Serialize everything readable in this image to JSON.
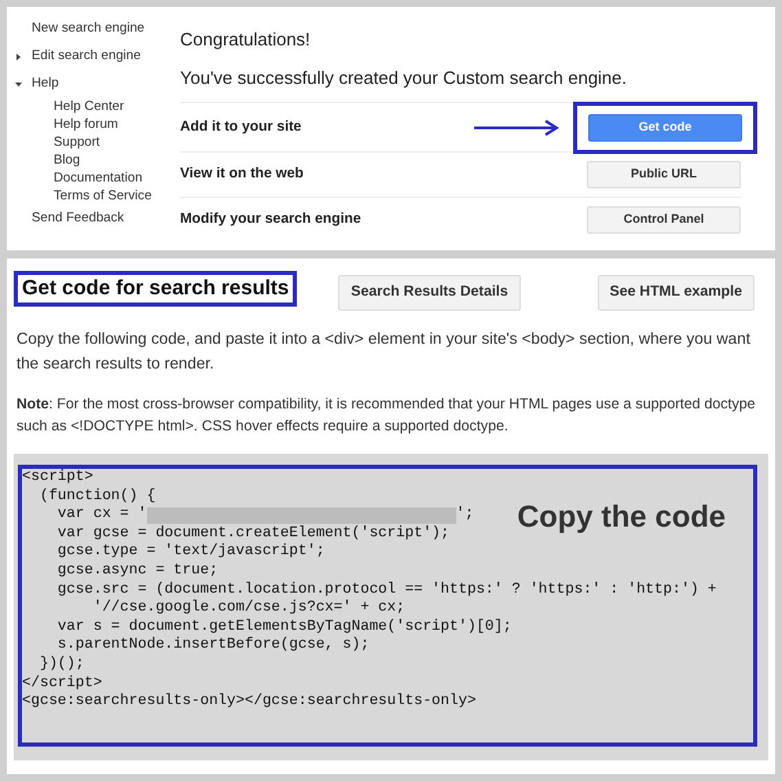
{
  "sidebar": {
    "items": [
      {
        "kind": "link",
        "label": "New search engine"
      },
      {
        "kind": "expandable",
        "label": "Edit search engine",
        "expanded": false
      },
      {
        "kind": "expandable",
        "label": "Help",
        "expanded": true,
        "children": [
          "Help Center",
          "Help forum",
          "Support",
          "Blog",
          "Documentation",
          "Terms of Service"
        ]
      },
      {
        "kind": "link",
        "label": "Send Feedback"
      }
    ]
  },
  "top": {
    "heading": "Congratulations!",
    "subheading": "You've successfully created your Custom search engine.",
    "rows": [
      {
        "label": "Add it to your site",
        "button": "Get code",
        "primary": true,
        "highlighted": true
      },
      {
        "label": "View it on the web",
        "button": "Public URL",
        "primary": false,
        "highlighted": false
      },
      {
        "label": "Modify your search engine",
        "button": "Control Panel",
        "primary": false,
        "highlighted": false
      }
    ]
  },
  "bottom": {
    "title": "Get code for search results",
    "title_highlighted": true,
    "buttons": [
      "Search Results Details",
      "See HTML example"
    ],
    "intro": "Copy the following code, and paste it into a <div> element in your site's <body> section, where you want the search results to render.",
    "note": "**Note**: For the most cross-browser compatibility, it is recommended that your HTML pages use a supported doctype such as <!DOCTYPE html>. CSS hover effects require a supported doctype.",
    "code_callout": "Copy the code",
    "code_lines": [
      {
        "kind": "text",
        "text": "<script>"
      },
      {
        "kind": "text",
        "text": "  (function() {"
      },
      {
        "kind": "redacted",
        "before": "    var cx = '",
        "after": "';"
      },
      {
        "kind": "text",
        "text": "    var gcse = document.createElement('script');"
      },
      {
        "kind": "text",
        "text": "    gcse.type = 'text/javascript';"
      },
      {
        "kind": "text",
        "text": "    gcse.async = true;"
      },
      {
        "kind": "text",
        "text": "    gcse.src = (document.location.protocol == 'https:' ? 'https:' : 'http:') +"
      },
      {
        "kind": "text",
        "text": "        '//cse.google.com/cse.js?cx=' + cx;"
      },
      {
        "kind": "text",
        "text": "    var s = document.getElementsByTagName('script')[0];"
      },
      {
        "kind": "text",
        "text": "    s.parentNode.insertBefore(gcse, s);"
      },
      {
        "kind": "text",
        "text": "  })();"
      },
      {
        "kind": "text",
        "text": "</script>"
      },
      {
        "kind": "text",
        "text": "<gcse:searchresults-only></gcse:searchresults-only>"
      }
    ]
  }
}
